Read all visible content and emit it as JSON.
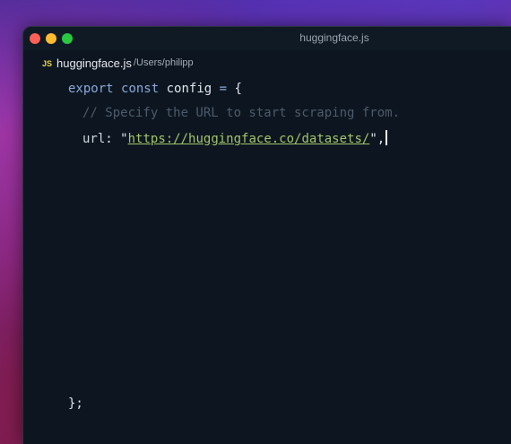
{
  "window": {
    "title": "huggingface.js"
  },
  "file": {
    "badge": "JS",
    "name": "huggingface.js",
    "path": "/Users/philipp"
  },
  "code": {
    "line1": {
      "export": "export",
      "const": "const",
      "name": "config",
      "eq": "=",
      "brace": "{"
    },
    "line2": {
      "comment": "// Specify the URL to start scraping from."
    },
    "line3": {
      "key": "url",
      "colon": ":",
      "quote_open": "\"",
      "url": "https://huggingface.co/datasets/",
      "quote_close": "\",",
      "comma": ","
    },
    "line4": {
      "close": "};"
    }
  },
  "colors": {
    "keyword": "#8aa8d8",
    "string_url": "#a3c46a",
    "comment": "#4d5a6a",
    "editor_bg": "#0d1620",
    "close_button": "#fe5f57",
    "minimize_button": "#febc2e",
    "maximize_button": "#28c840"
  }
}
